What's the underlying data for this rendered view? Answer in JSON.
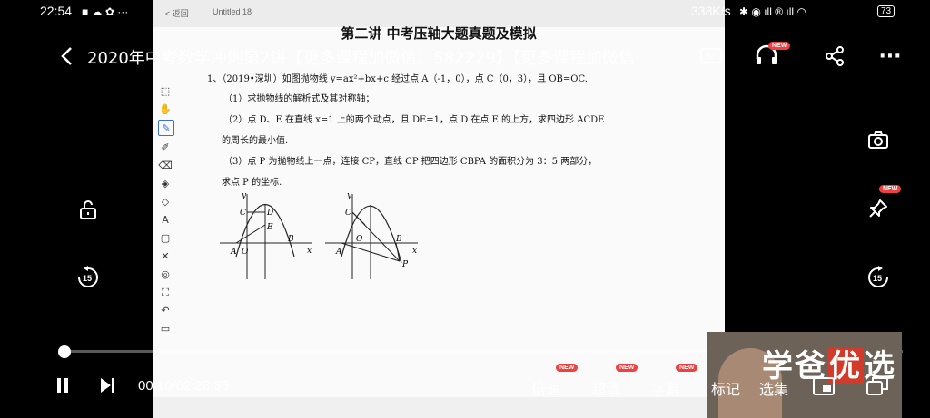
{
  "status_bar": {
    "time": "22:54",
    "network_speed": "338K/s",
    "battery": "73"
  },
  "whiteboard": {
    "tab_back": "< 返回",
    "file_name": "Untitled 18",
    "lecture_title": "第二讲  中考压轴大题真题及模拟",
    "question_intro": "1、（2019•深圳）如图抛物线 y=ax²+bx+c 经过点 A（-1，0），点 C（0，3），且 OB=OC.",
    "part1": "（1）求抛物线的解析式及其对称轴；",
    "part2_a": "（2）点 D、E 在直线 x=1 上的两个动点，且 DE=1，点 D 在点 E 的上方，求四边形 ACDE",
    "part2_b": "的周长的最小值.",
    "part3_a": "（3）点 P 为抛物线上一点，连接 CP，直线 CP 把四边形 CBPA 的面积分为 3：5 两部分，",
    "part3_b": "求点 P 的坐标.",
    "graph1_labels": {
      "y": "y",
      "x": "x",
      "c": "C",
      "d": "D",
      "e": "E",
      "a": "A",
      "o": "O",
      "b": "B"
    },
    "graph2_labels": {
      "y": "y",
      "x": "x",
      "c": "C",
      "a": "A",
      "o": "O",
      "b": "B",
      "p": "P"
    },
    "tools": [
      "select-icon",
      "hand-icon",
      "pen-icon",
      "highlighter-icon",
      "eraser-icon",
      "fill-icon",
      "shape-icon",
      "text-icon",
      "frame-icon",
      "close-icon",
      "circle-icon",
      "crop-icon",
      "undo-icon",
      "delete-icon"
    ]
  },
  "header": {
    "title": "2020年中考数学冲刺第2讲【更多课程加微信：582229】【更多课程加微信"
  },
  "badges": {
    "new": "NEW"
  },
  "playback": {
    "time": "00:10/02:28:35",
    "progress_fraction": 0.001
  },
  "bottom_menu": {
    "speed": "倍速",
    "quality": "超清",
    "subtitles": "字幕",
    "bookmark": "标记",
    "episodes": "选集"
  },
  "webcam": {
    "brand_pre": "学爸",
    "brand_highlight": "优",
    "brand_post": "选"
  },
  "colors": {
    "accent": "#f04040",
    "whiteboard_active": "#3b6fd8"
  }
}
